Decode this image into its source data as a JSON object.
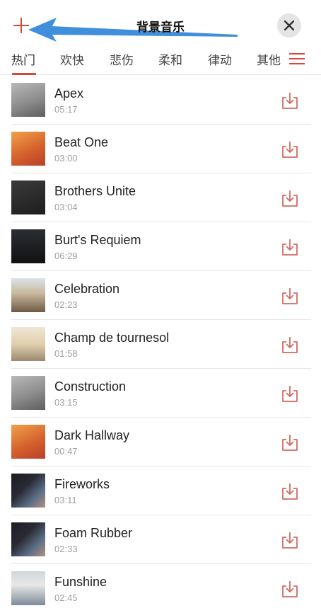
{
  "header": {
    "title": "背景音乐",
    "add_icon": "plus-icon",
    "close_icon": "close-icon",
    "arrow_annotation": "blue-arrow-pointing-left",
    "accent_color": "#d9463c",
    "arrow_color": "#3f8fdc"
  },
  "tabs": [
    {
      "label": "热门",
      "active": true
    },
    {
      "label": "欢快",
      "active": false
    },
    {
      "label": "悲伤",
      "active": false
    },
    {
      "label": "柔和",
      "active": false
    },
    {
      "label": "律动",
      "active": false
    },
    {
      "label": "其他",
      "active": false
    }
  ],
  "menu_icon": "hamburger-menu-icon",
  "songs": [
    {
      "title": "Apex",
      "duration": "05:17"
    },
    {
      "title": "Beat One",
      "duration": "03:00"
    },
    {
      "title": "Brothers Unite",
      "duration": "03:04"
    },
    {
      "title": "Burt's Requiem",
      "duration": "06:29"
    },
    {
      "title": "Celebration",
      "duration": "02:23"
    },
    {
      "title": "Champ de tournesol",
      "duration": "01:58"
    },
    {
      "title": "Construction",
      "duration": "03:15"
    },
    {
      "title": "Dark Hallway",
      "duration": "00:47"
    },
    {
      "title": "Fireworks",
      "duration": "03:11"
    },
    {
      "title": "Foam Rubber",
      "duration": "02:33"
    },
    {
      "title": "Funshine",
      "duration": "02:45"
    }
  ],
  "download_icon": "download-icon"
}
